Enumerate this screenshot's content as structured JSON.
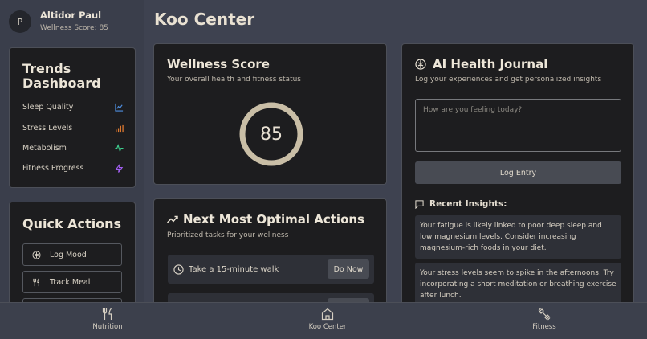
{
  "user": {
    "initial": "P",
    "name": "Altidor Paul",
    "score_text": "Wellness Score: 85"
  },
  "page_title": "Koo Center",
  "trends": {
    "title": "Trends Dashboard",
    "items": [
      {
        "label": "Sleep Quality",
        "icon": "chart-line-icon",
        "color": "#4f8fe0"
      },
      {
        "label": "Stress Levels",
        "icon": "bar-chart-icon",
        "color": "#e07a30"
      },
      {
        "label": "Metabolism",
        "icon": "pulse-icon",
        "color": "#3ecf8e"
      },
      {
        "label": "Fitness Progress",
        "icon": "lightning-icon",
        "color": "#a15ef0"
      }
    ]
  },
  "quick_actions": {
    "title": "Quick Actions",
    "items": [
      {
        "label": "Log Mood",
        "icon": "brain-icon"
      },
      {
        "label": "Track Meal",
        "icon": "utensils-icon"
      }
    ]
  },
  "wellness": {
    "title": "Wellness Score",
    "subtitle": "Your overall health and fitness status",
    "score": "85",
    "score_fraction": 1.0
  },
  "optimal": {
    "title": "Next Most Optimal Actions",
    "subtitle": "Prioritized tasks for your wellness",
    "tasks": [
      {
        "label": "Take a 15-minute walk",
        "action": "Do Now"
      }
    ]
  },
  "journal": {
    "title": "AI Health Journal",
    "subtitle": "Log your experiences and get personalized insights",
    "placeholder": "How are you feeling today?",
    "log_button": "Log Entry",
    "insights_title": "Recent Insights:",
    "insights": [
      "Your fatigue is likely linked to poor deep sleep and low magnesium levels. Consider increasing magnesium-rich foods in your diet.",
      "Your stress levels seem to spike in the afternoons. Try incorporating a short meditation or breathing exercise after lunch."
    ]
  },
  "nav": {
    "items": [
      {
        "label": "Nutrition",
        "icon": "utensils-icon"
      },
      {
        "label": "Koo Center",
        "icon": "home-icon"
      },
      {
        "label": "Fitness",
        "icon": "dumbbell-icon"
      }
    ]
  },
  "colors": {
    "background": "#3e4250",
    "card": "#1d1d1f",
    "accent_ring": "#c9bea6"
  }
}
